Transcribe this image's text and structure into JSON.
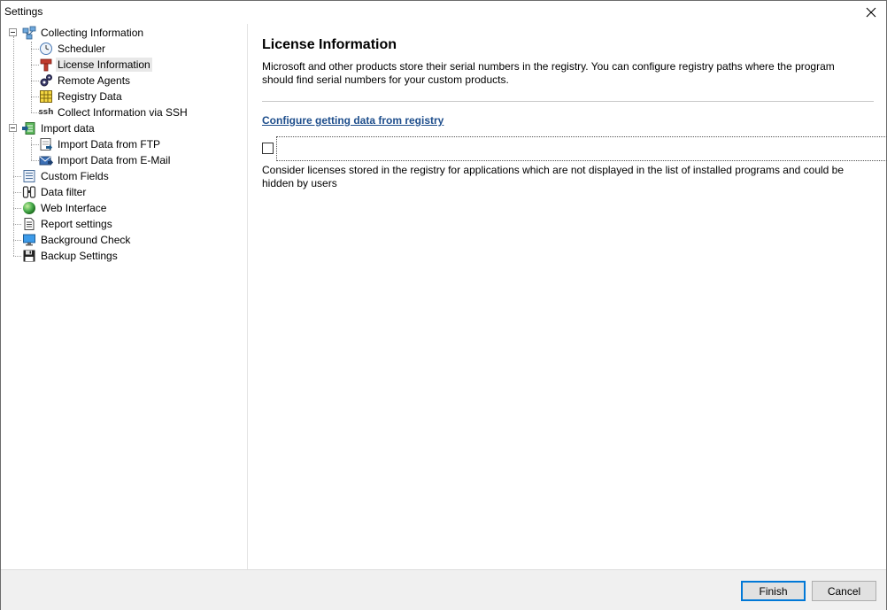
{
  "window": {
    "title": "Settings",
    "close_icon": "close-icon"
  },
  "sidebar": {
    "items": [
      {
        "label": "Collecting Information",
        "icon": "network-collect-icon"
      },
      {
        "label": "Scheduler",
        "icon": "clock-icon"
      },
      {
        "label": "License Information",
        "icon": "license-key-icon",
        "selected": true
      },
      {
        "label": "Remote Agents",
        "icon": "gears-icon"
      },
      {
        "label": "Registry Data",
        "icon": "registry-grid-icon"
      },
      {
        "label": "Collect Information via SSH",
        "icon": "ssh-icon",
        "icon_text": "ssh"
      },
      {
        "label": "Import data",
        "icon": "import-icon"
      },
      {
        "label": "Import Data from FTP",
        "icon": "ftp-import-icon"
      },
      {
        "label": "Import Data from E-Mail",
        "icon": "email-import-icon"
      },
      {
        "label": "Custom Fields",
        "icon": "custom-fields-icon"
      },
      {
        "label": "Data filter",
        "icon": "binoculars-icon"
      },
      {
        "label": "Web Interface",
        "icon": "globe-icon"
      },
      {
        "label": "Report settings",
        "icon": "report-icon"
      },
      {
        "label": "Background Check",
        "icon": "monitor-icon"
      },
      {
        "label": "Backup Settings",
        "icon": "floppy-disk-icon"
      }
    ]
  },
  "main": {
    "title": "License Information",
    "description": "Microsoft and other products store their serial numbers in the registry. You can configure registry paths where the program should find serial numbers for your custom products.",
    "registry_link": "Configure getting data from registry",
    "checkbox": {
      "checked": false,
      "label": "Consider licenses stored in the registry for applications which are not displayed in the list of installed programs and could be hidden by users"
    }
  },
  "footer": {
    "finish_label": "Finish",
    "cancel_label": "Cancel"
  },
  "colors": {
    "link": "#1e4e8c",
    "selection": "#e8e8e8",
    "primary_button_border": "#0078d7",
    "footer_bg": "#f0f0f0"
  }
}
